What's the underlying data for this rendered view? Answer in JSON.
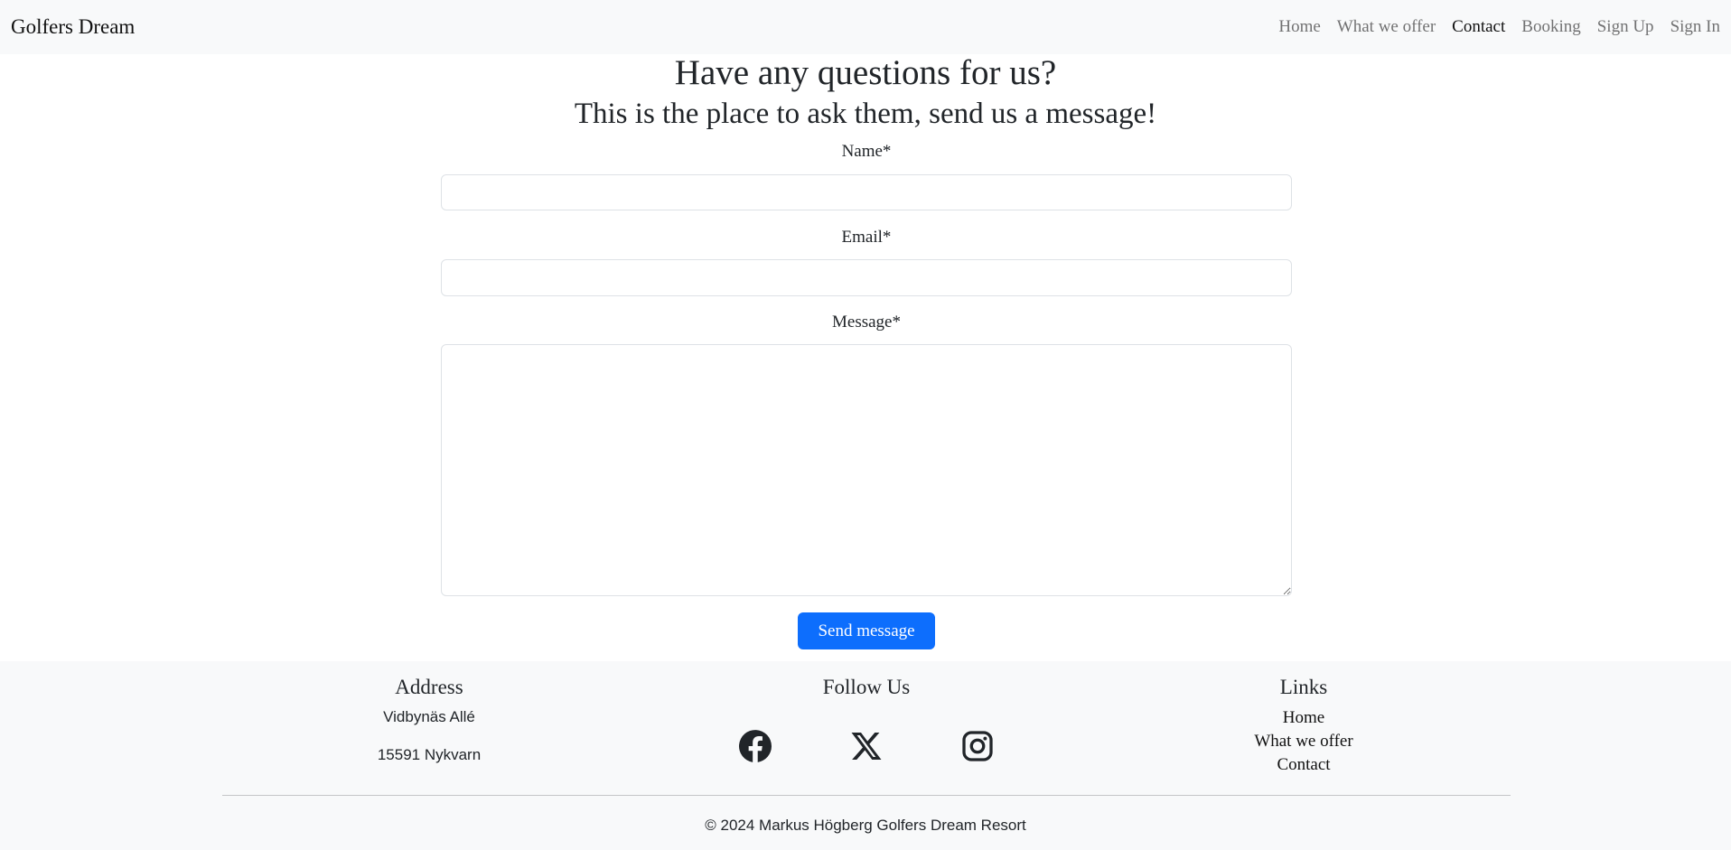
{
  "nav": {
    "brand": "Golfers Dream",
    "items": [
      "Home",
      "What we offer",
      "Contact",
      "Booking",
      "Sign Up",
      "Sign In"
    ],
    "active": "Contact"
  },
  "heading": "Have any questions for us?",
  "subheading": "This is the place to ask them, send us a message!",
  "form": {
    "name_label": "Name*",
    "name_value": "",
    "email_label": "Email*",
    "email_value": "",
    "message_label": "Message*",
    "message_value": "",
    "submit": "Send message",
    "accent": "#0d6efd"
  },
  "footer": {
    "address_title": "Address",
    "address_line1": "Vidbynäs Allé",
    "address_line2": "15591 Nykvarn",
    "follow_title": "Follow Us",
    "social": [
      "facebook-icon",
      "x-icon",
      "instagram-icon"
    ],
    "links_title": "Links",
    "links": [
      "Home",
      "What we offer",
      "Contact"
    ],
    "copyright": "© 2024 Markus Högberg Golfers Dream Resort"
  }
}
